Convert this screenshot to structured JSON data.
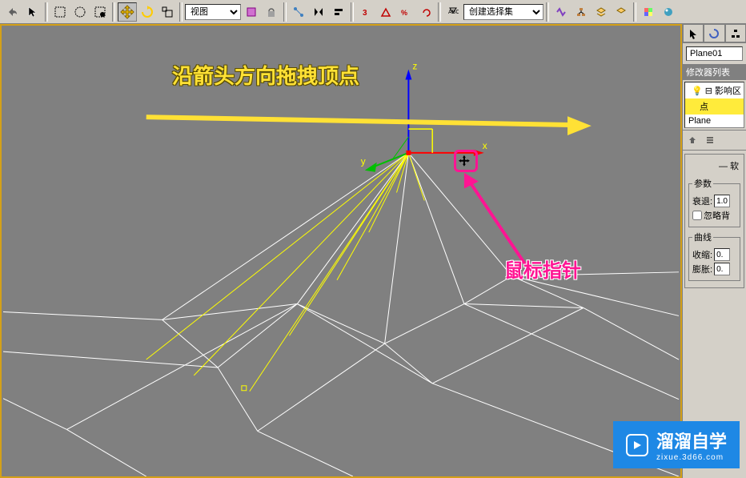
{
  "toolbar": {
    "view_combo": "视图",
    "selset_combo": "创建选择集"
  },
  "gizmo": {
    "x": "x",
    "y": "y",
    "z": "z"
  },
  "panel": {
    "object_name": "Plane01",
    "modlist_title": "修改器列表",
    "stack_mod": "影响区",
    "stack_sub": "点",
    "stack_base": "Plane",
    "rollout_soft": "软",
    "group_params": "参数",
    "falloff_label": "衰退:",
    "falloff_value": "1.0",
    "ignore_back": "忽略背",
    "group_curve": "曲线",
    "shrink_label": "收缩:",
    "shrink_value": "0.",
    "expand_label": "膨胀:",
    "expand_value": "0."
  },
  "annotations": {
    "drag_hint": "沿箭头方向拖拽顶点",
    "cursor_hint": "鼠标指针"
  },
  "watermark": {
    "title": "溜溜自学",
    "sub": "zixue.3d66.com"
  }
}
